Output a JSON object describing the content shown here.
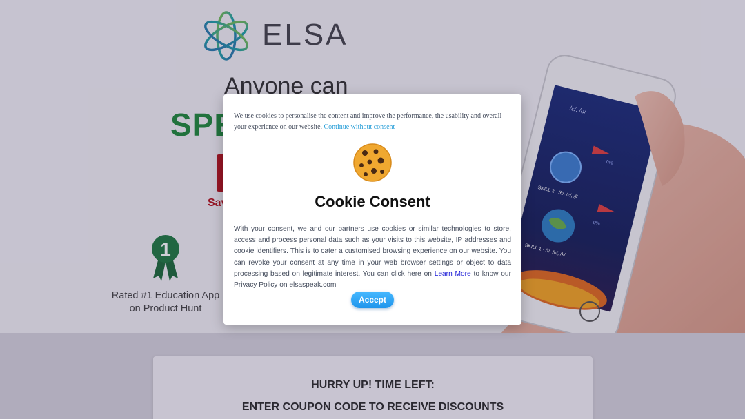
{
  "background": {
    "logo_text": "ELSA",
    "hero_sub": "Anyone can",
    "hero_big": "SPE",
    "save_text": "Sav",
    "rating": {
      "badge_number": "1",
      "line1": "Rated #1 Education App",
      "line2": "on Product Hunt"
    },
    "promo": {
      "hurry": "HURRY UP! TIME LEFT:",
      "coupon": "ENTER COUPON CODE TO RECEIVE DISCOUNTS"
    },
    "phone_screen": {
      "row1": "/ɛ/, /ʊ/",
      "skill2": "SKILL 2 · /θ/, /ɛ/, /ʃ/",
      "skill1": "SKILL 1 · /ɪ/, /ʊ/, /k/",
      "pct1": "0%",
      "pct2": "0%"
    }
  },
  "modal": {
    "intro_text": "We use cookies to personalise the content and improve the performance, the usability and overall your experience on our website.",
    "intro_link": "Continue without consent",
    "title": "Cookie Consent",
    "body_text": "With your consent, we and our partners use cookies or similar technologies to store, access and process personal data such as your visits to this website, IP addresses and cookie identifiers. This is to cater a customised browsing experience on our website. You can revoke your consent at any time in your web browser settings or object to data processing based on legitimate interest. You can click here on",
    "learn_more": "Learn More",
    "body_suffix": "to know our Privacy Policy on elsaspeak.com",
    "accept_label": "Accept"
  },
  "colors": {
    "brand_green": "#1f8a3b",
    "brand_red": "#b4121c",
    "link_blue": "#2a9fd8",
    "accept_blue": "#1f95ec"
  },
  "icons": {
    "logo": "elsa-star-logo",
    "badge": "rank-one-ribbon-icon",
    "cookie": "cookie-icon"
  }
}
